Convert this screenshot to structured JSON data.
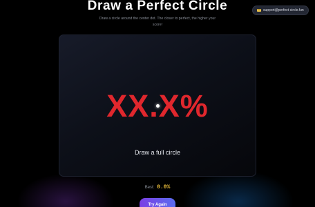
{
  "header": {
    "title": "Draw a Perfect Circle",
    "subtitle": "Draw a circle around the center dot. The closer to perfect, the higher your score!"
  },
  "support": {
    "icon": "mail-icon",
    "email": "support@perfect-circle.fun"
  },
  "canvas": {
    "score": "XX.X%",
    "prompt": "Draw a full circle"
  },
  "best": {
    "label": "Best:",
    "value": "0.0%"
  },
  "actions": {
    "try_again": "Try Again"
  },
  "colors": {
    "background": "#000000",
    "score": "#e0272d",
    "best_value": "#f0c23c",
    "button_start": "#7b3fe4",
    "button_end": "#5a6cf0"
  }
}
